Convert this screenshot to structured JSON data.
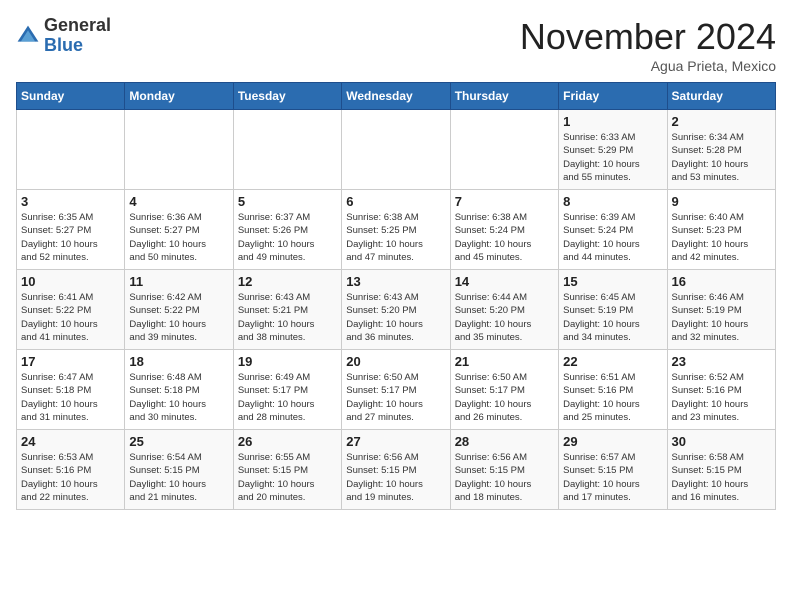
{
  "header": {
    "logo_general": "General",
    "logo_blue": "Blue",
    "month_title": "November 2024",
    "location": "Agua Prieta, Mexico"
  },
  "weekdays": [
    "Sunday",
    "Monday",
    "Tuesday",
    "Wednesday",
    "Thursday",
    "Friday",
    "Saturday"
  ],
  "weeks": [
    [
      {
        "day": "",
        "info": ""
      },
      {
        "day": "",
        "info": ""
      },
      {
        "day": "",
        "info": ""
      },
      {
        "day": "",
        "info": ""
      },
      {
        "day": "",
        "info": ""
      },
      {
        "day": "1",
        "info": "Sunrise: 6:33 AM\nSunset: 5:29 PM\nDaylight: 10 hours and 55 minutes."
      },
      {
        "day": "2",
        "info": "Sunrise: 6:34 AM\nSunset: 5:28 PM\nDaylight: 10 hours and 53 minutes."
      }
    ],
    [
      {
        "day": "3",
        "info": "Sunrise: 6:35 AM\nSunset: 5:27 PM\nDaylight: 10 hours and 52 minutes."
      },
      {
        "day": "4",
        "info": "Sunrise: 6:36 AM\nSunset: 5:27 PM\nDaylight: 10 hours and 50 minutes."
      },
      {
        "day": "5",
        "info": "Sunrise: 6:37 AM\nSunset: 5:26 PM\nDaylight: 10 hours and 49 minutes."
      },
      {
        "day": "6",
        "info": "Sunrise: 6:38 AM\nSunset: 5:25 PM\nDaylight: 10 hours and 47 minutes."
      },
      {
        "day": "7",
        "info": "Sunrise: 6:38 AM\nSunset: 5:24 PM\nDaylight: 10 hours and 45 minutes."
      },
      {
        "day": "8",
        "info": "Sunrise: 6:39 AM\nSunset: 5:24 PM\nDaylight: 10 hours and 44 minutes."
      },
      {
        "day": "9",
        "info": "Sunrise: 6:40 AM\nSunset: 5:23 PM\nDaylight: 10 hours and 42 minutes."
      }
    ],
    [
      {
        "day": "10",
        "info": "Sunrise: 6:41 AM\nSunset: 5:22 PM\nDaylight: 10 hours and 41 minutes."
      },
      {
        "day": "11",
        "info": "Sunrise: 6:42 AM\nSunset: 5:22 PM\nDaylight: 10 hours and 39 minutes."
      },
      {
        "day": "12",
        "info": "Sunrise: 6:43 AM\nSunset: 5:21 PM\nDaylight: 10 hours and 38 minutes."
      },
      {
        "day": "13",
        "info": "Sunrise: 6:43 AM\nSunset: 5:20 PM\nDaylight: 10 hours and 36 minutes."
      },
      {
        "day": "14",
        "info": "Sunrise: 6:44 AM\nSunset: 5:20 PM\nDaylight: 10 hours and 35 minutes."
      },
      {
        "day": "15",
        "info": "Sunrise: 6:45 AM\nSunset: 5:19 PM\nDaylight: 10 hours and 34 minutes."
      },
      {
        "day": "16",
        "info": "Sunrise: 6:46 AM\nSunset: 5:19 PM\nDaylight: 10 hours and 32 minutes."
      }
    ],
    [
      {
        "day": "17",
        "info": "Sunrise: 6:47 AM\nSunset: 5:18 PM\nDaylight: 10 hours and 31 minutes."
      },
      {
        "day": "18",
        "info": "Sunrise: 6:48 AM\nSunset: 5:18 PM\nDaylight: 10 hours and 30 minutes."
      },
      {
        "day": "19",
        "info": "Sunrise: 6:49 AM\nSunset: 5:17 PM\nDaylight: 10 hours and 28 minutes."
      },
      {
        "day": "20",
        "info": "Sunrise: 6:50 AM\nSunset: 5:17 PM\nDaylight: 10 hours and 27 minutes."
      },
      {
        "day": "21",
        "info": "Sunrise: 6:50 AM\nSunset: 5:17 PM\nDaylight: 10 hours and 26 minutes."
      },
      {
        "day": "22",
        "info": "Sunrise: 6:51 AM\nSunset: 5:16 PM\nDaylight: 10 hours and 25 minutes."
      },
      {
        "day": "23",
        "info": "Sunrise: 6:52 AM\nSunset: 5:16 PM\nDaylight: 10 hours and 23 minutes."
      }
    ],
    [
      {
        "day": "24",
        "info": "Sunrise: 6:53 AM\nSunset: 5:16 PM\nDaylight: 10 hours and 22 minutes."
      },
      {
        "day": "25",
        "info": "Sunrise: 6:54 AM\nSunset: 5:15 PM\nDaylight: 10 hours and 21 minutes."
      },
      {
        "day": "26",
        "info": "Sunrise: 6:55 AM\nSunset: 5:15 PM\nDaylight: 10 hours and 20 minutes."
      },
      {
        "day": "27",
        "info": "Sunrise: 6:56 AM\nSunset: 5:15 PM\nDaylight: 10 hours and 19 minutes."
      },
      {
        "day": "28",
        "info": "Sunrise: 6:56 AM\nSunset: 5:15 PM\nDaylight: 10 hours and 18 minutes."
      },
      {
        "day": "29",
        "info": "Sunrise: 6:57 AM\nSunset: 5:15 PM\nDaylight: 10 hours and 17 minutes."
      },
      {
        "day": "30",
        "info": "Sunrise: 6:58 AM\nSunset: 5:15 PM\nDaylight: 10 hours and 16 minutes."
      }
    ]
  ]
}
